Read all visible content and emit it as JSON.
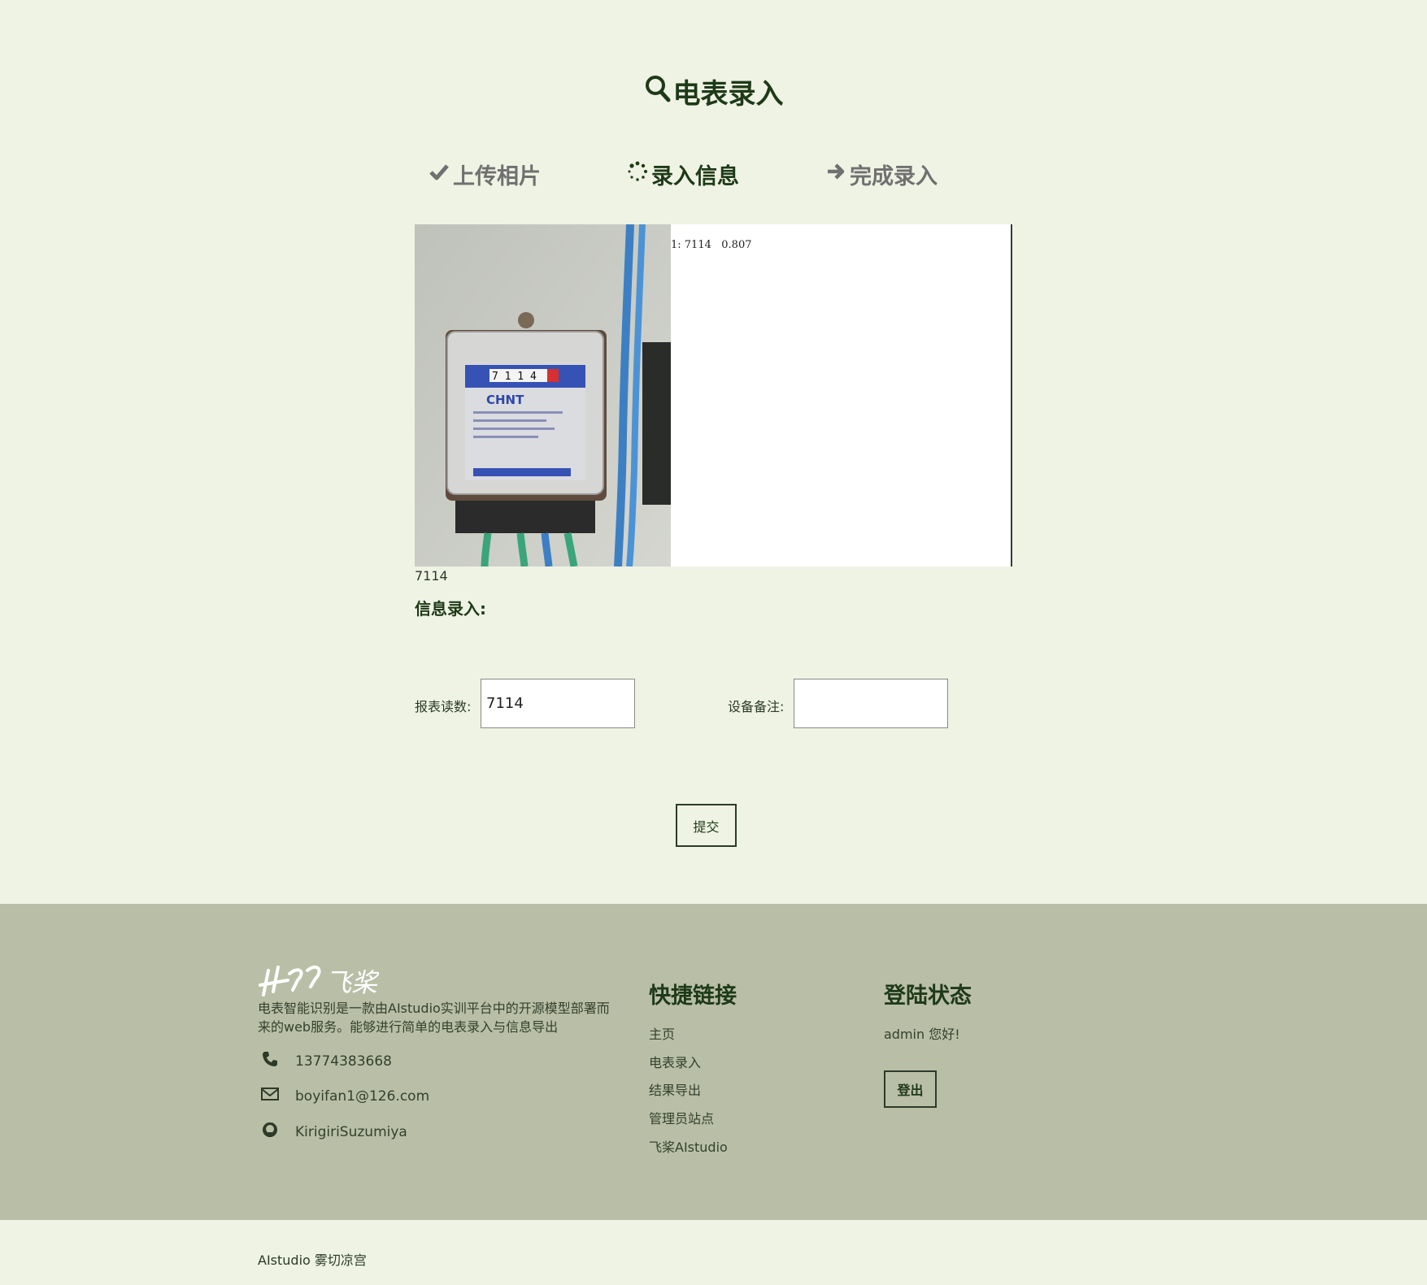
{
  "header": {
    "title": "电表录入"
  },
  "steps": [
    {
      "label": "上传相片",
      "state": "done"
    },
    {
      "label": "录入信息",
      "state": "active"
    },
    {
      "label": "完成录入",
      "state": "pending"
    }
  ],
  "result": {
    "ocr_line": "1: 7114   0.807",
    "reading_caption": "7114"
  },
  "form": {
    "heading": "信息录入:",
    "reading_label": "报表读数:",
    "reading_value": "7114",
    "note_label": "设备备注:",
    "note_value": "",
    "submit_label": "提交"
  },
  "footer": {
    "logo_text": "飞桨",
    "description": "电表智能识别是一款由AIstudio实训平台中的开源模型部署而来的web服务。能够进行简单的电表录入与信息导出",
    "phone": "13774383668",
    "email": "boyifan1@126.com",
    "github": "KirigiriSuzumiya",
    "quick_links_heading": "快捷链接",
    "quick_links": [
      "主页",
      "电表录入",
      "结果导出",
      "管理员站点",
      "飞桨AIstudio"
    ],
    "login_heading": "登陆状态",
    "greeting": "admin 您好!",
    "logout_label": "登出",
    "copyright": "AIstudio 雾切凉宫"
  },
  "colors": {
    "background": "#eff3e4",
    "footer": "#b9bfa6",
    "text_dark": "#1e3a18"
  }
}
